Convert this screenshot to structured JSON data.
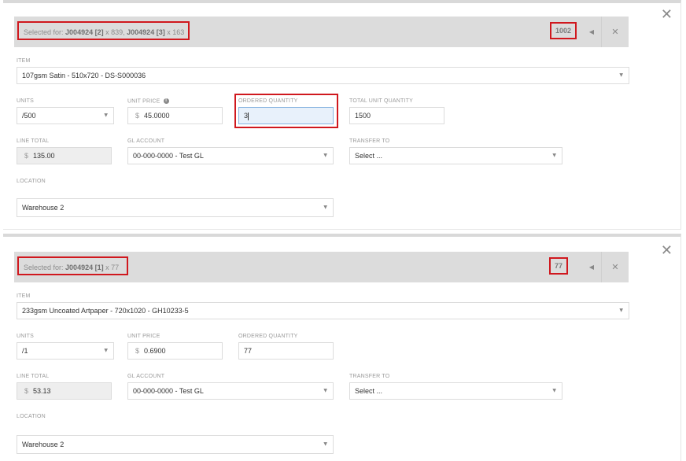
{
  "close_glyph": "✕",
  "bar_close_glyph": "✕",
  "prev_glyph": "◀",
  "caret_glyph": "▼",
  "info_glyph": "i",
  "currency": "$",
  "panels": [
    {
      "selected_prefix": "Selected for:",
      "job1": "J004924 [2]",
      "qty1": "x 839,",
      "job2": "J004924 [3]",
      "qty2": "x 163",
      "badge": "1002",
      "item_label": "ITEM",
      "item_value": "107gsm Satin - 510x720 - DS-S000036",
      "units_label": "UNITS",
      "units_value": "/500",
      "unit_price_label": "UNIT PRICE",
      "unit_price_value": "45.0000",
      "ordered_qty_label": "ORDERED QUANTITY",
      "ordered_qty_value": "3",
      "total_unit_qty_label": "TOTAL UNIT QUANTITY",
      "total_unit_qty_value": "1500",
      "line_total_label": "LINE TOTAL",
      "line_total_value": "135.00",
      "gl_account_label": "GL ACCOUNT",
      "gl_account_value": "00-000-0000 - Test GL",
      "transfer_to_label": "TRANSFER TO",
      "transfer_to_value": "Select ...",
      "location_label": "LOCATION",
      "location_value": "Warehouse 2"
    },
    {
      "selected_prefix": "Selected for:",
      "job1": "J004924 [1]",
      "qty1": "x 77",
      "badge": "77",
      "item_label": "ITEM",
      "item_value": "233gsm Uncoated Artpaper - 720x1020 - GH10233-5",
      "units_label": "UNITS",
      "units_value": "/1",
      "unit_price_label": "UNIT PRICE",
      "unit_price_value": "0.6900",
      "ordered_qty_label": "ORDERED QUANTITY",
      "ordered_qty_value": "77",
      "line_total_label": "LINE TOTAL",
      "line_total_value": "53.13",
      "gl_account_label": "GL ACCOUNT",
      "gl_account_value": "00-000-0000 - Test GL",
      "transfer_to_label": "TRANSFER TO",
      "transfer_to_value": "Select ...",
      "location_label": "LOCATION",
      "location_value": "Warehouse 2"
    }
  ]
}
